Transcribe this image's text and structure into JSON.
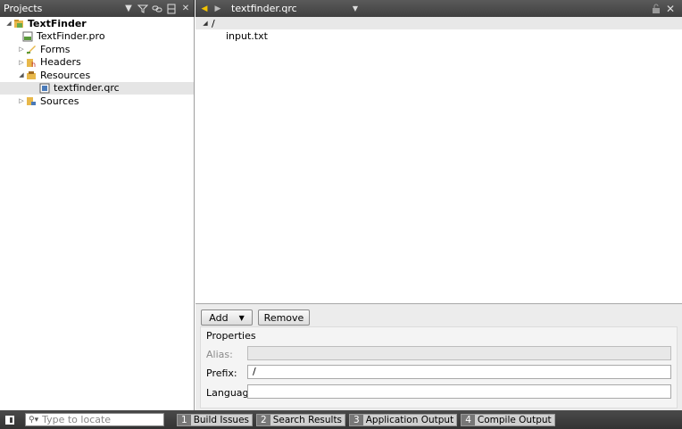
{
  "left_panel": {
    "title": "Projects",
    "tree": [
      {
        "label": "TextFinder",
        "bold": true,
        "level": 0,
        "expanded": true
      },
      {
        "label": "TextFinder.pro",
        "level": 1
      },
      {
        "label": "Forms",
        "level": 1,
        "collapsed": true
      },
      {
        "label": "Headers",
        "level": 1,
        "collapsed": true
      },
      {
        "label": "Resources",
        "level": 1,
        "expanded": true
      },
      {
        "label": "textfinder.qrc",
        "level": 2,
        "selected": true
      },
      {
        "label": "Sources",
        "level": 1,
        "collapsed": true
      }
    ]
  },
  "editor": {
    "document": "textfinder.qrc",
    "prefix_row": "/",
    "file_row": "input.txt"
  },
  "form": {
    "add_label": "Add",
    "remove_label": "Remove",
    "properties_title": "Properties",
    "alias_label": "Alias:",
    "alias_value": "",
    "prefix_label": "Prefix:",
    "prefix_value": "/",
    "language_label": "Language:",
    "language_value": ""
  },
  "statusbar": {
    "locate_placeholder": "Type to locate",
    "tabs": [
      {
        "num": "1",
        "label": "Build Issues"
      },
      {
        "num": "2",
        "label": "Search Results"
      },
      {
        "num": "3",
        "label": "Application Output"
      },
      {
        "num": "4",
        "label": "Compile Output"
      }
    ]
  }
}
